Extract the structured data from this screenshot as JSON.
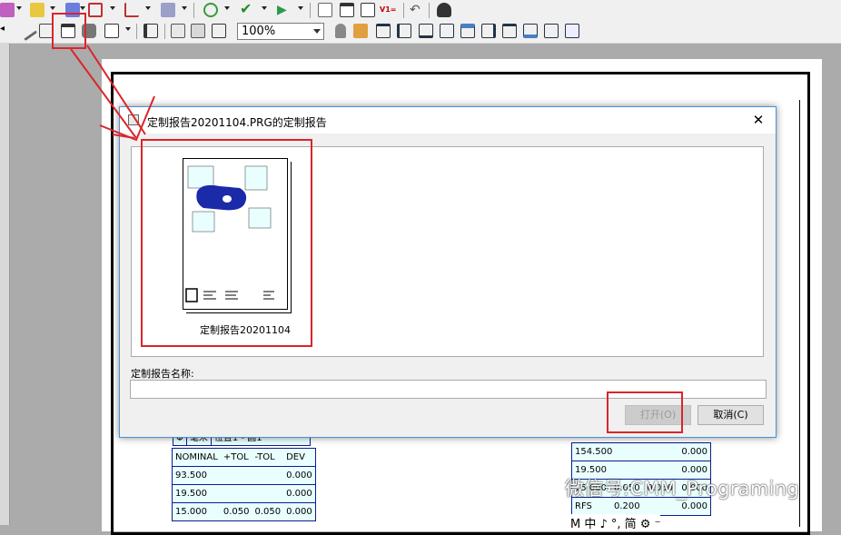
{
  "toolbar_main": {
    "icons": [
      "open-icon",
      "folder-icon",
      "wizard-icon",
      "grid-icon",
      "axes-icon",
      "filter-icon",
      "probe-icon",
      "check-icon",
      "play-icon",
      "report-text-icon",
      "report-window-icon",
      "report-layout-icon",
      "version-icon",
      "undo-icon",
      "user-icon"
    ],
    "version_label": "V1="
  },
  "toolbar_report": {
    "zoom_value": "100%"
  },
  "dialog": {
    "title": "定制报告20201104.PRG的定制报告",
    "close_glyph": "✕",
    "template_name": "定制报告20201104",
    "name_label": "定制报告名称:",
    "name_value": "",
    "open_button": "打开(O)",
    "cancel_button": "取消(C)"
  },
  "report_left": {
    "header": [
      "Φ",
      "毫米",
      "位置1 - 圆1"
    ],
    "columns": [
      "NOMINAL",
      "+TOL",
      "-TOL",
      "DEV"
    ],
    "rows": [
      [
        "93.500",
        "",
        "",
        "0.000"
      ],
      [
        "19.500",
        "",
        "",
        "0.000"
      ],
      [
        "15.000",
        "0.050",
        "0.050",
        "0.000"
      ]
    ]
  },
  "report_right": {
    "rows": [
      [
        "154.500",
        "0.000"
      ],
      [
        "19.500",
        "0.000"
      ],
      [
        "15.000",
        "0.050",
        "0.050",
        "0.000"
      ],
      [
        "RFS",
        "0.200",
        "",
        "0.000"
      ]
    ]
  },
  "watermark": "微信号:CMM_Programing",
  "glyph_strip": "M 中 ♪ °, 简 ⚙ ⁻",
  "colors": {
    "highlight_red": "#d9262b",
    "report_cell_bg": "#e9ffff",
    "report_border": "#0b1c8e",
    "dialog_border": "#4a90d9"
  }
}
